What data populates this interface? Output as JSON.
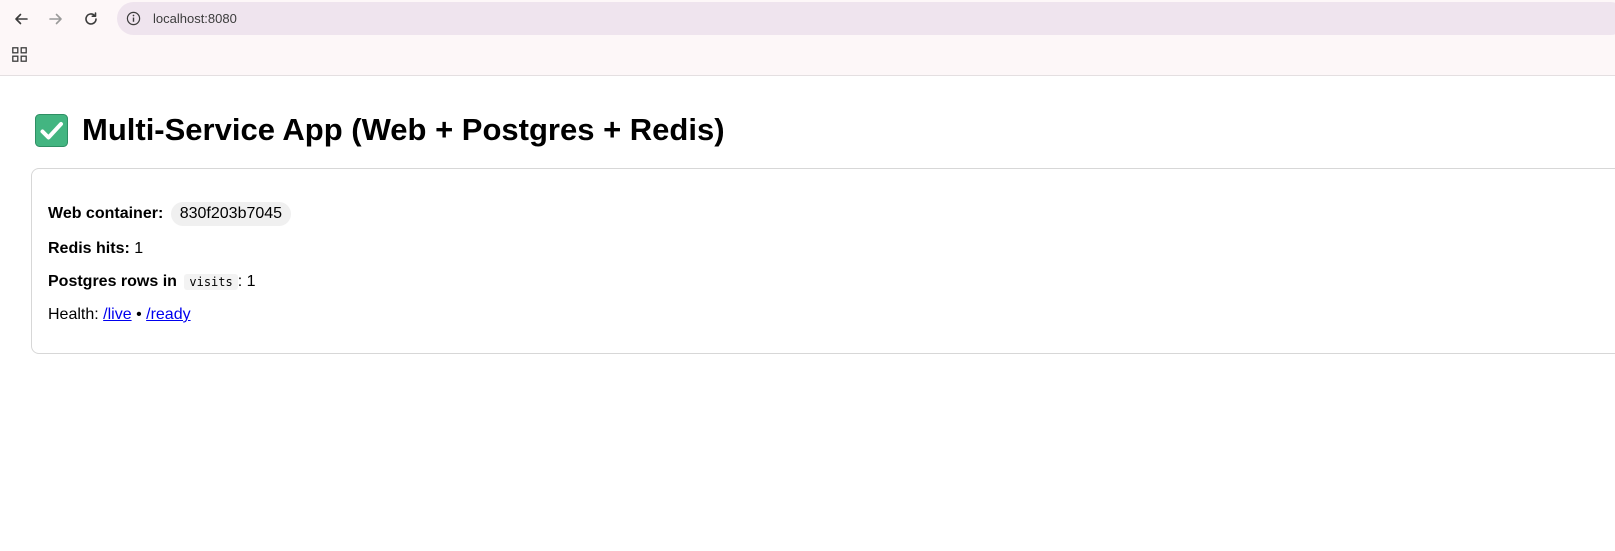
{
  "browser": {
    "url": "localhost:8080",
    "icons": [
      "back-arrow-icon",
      "forward-arrow-icon",
      "reload-icon",
      "info-icon",
      "apps-grid-icon"
    ]
  },
  "page": {
    "title_icon": "check-mark-button-icon",
    "title": "Multi-Service App (Web + Postgres + Redis)",
    "web_container_label": "Web container:",
    "web_container_id": "830f203b7045",
    "redis_hits_label": "Redis hits:",
    "redis_hits_value": "1",
    "postgres_label": "Postgres rows in",
    "postgres_table": "visits",
    "postgres_rows_value": ": 1",
    "health_label": "Health:",
    "health_live_link": "/live",
    "health_separator": "•",
    "health_ready_link": "/ready"
  },
  "colors": {
    "check_green": "#43b581",
    "link_blue": "#0000ee",
    "address_bar_bg": "#efe4ee"
  }
}
